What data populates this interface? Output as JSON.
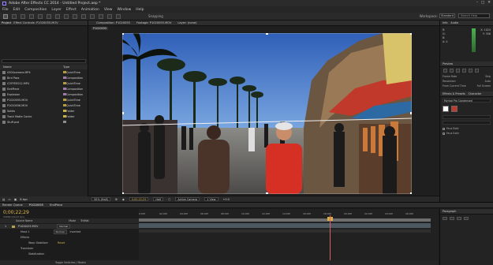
{
  "window": {
    "title": "Adobe After Effects CC 2014 - Untitled Project.aep *",
    "controls": [
      "–",
      "□",
      "✕"
    ]
  },
  "menu": [
    "File",
    "Edit",
    "Composition",
    "Layer",
    "Effect",
    "Animation",
    "View",
    "Window",
    "Help"
  ],
  "toolbar": {
    "snapping": "Snapping",
    "workspace_label": "Workspace:",
    "workspace_value": "Standard",
    "search_placeholder": "Search Help"
  },
  "project": {
    "tabs": [
      "Project",
      "Effect Controls: P1020055.MOV"
    ],
    "header_name": "Name",
    "header_type": "Type",
    "items": [
      {
        "name": "0300camera.MP4",
        "type": "QuickTime",
        "color": "#b39b42"
      },
      {
        "name": "Bird Pass",
        "type": "Composition",
        "color": "#a07aa6"
      },
      {
        "name": "COFFEE012.MP4",
        "type": "QuickTime",
        "color": "#b39b42"
      },
      {
        "name": "EndPiece",
        "type": "Composition",
        "color": "#a07aa6"
      },
      {
        "name": "Explosion",
        "type": "Composition",
        "color": "#a07aa6"
      },
      {
        "name": "P1020055.MOV",
        "type": "QuickTime",
        "color": "#b39b42"
      },
      {
        "name": "P1020056.MOV",
        "type": "QuickTime",
        "color": "#b39b42"
      },
      {
        "name": "Solids",
        "type": "Folder",
        "color": "#c7b24a"
      },
      {
        "name": "Track Matte Cache",
        "type": "Folder",
        "color": "#c7b24a"
      },
      {
        "name": "Stuff.psd",
        "type": "",
        "color": "#8d8d8d"
      }
    ],
    "bottom": "8 bpc"
  },
  "viewer": {
    "tabs": [
      "Composition: P1020055",
      "Footage: P1020055.MOV",
      "Layer: (none)"
    ],
    "crumb": "P1020055",
    "bottom": {
      "zoom": "50% (Half)",
      "timecode": "0;00;22;29",
      "resolution": "Half",
      "camera": "Active Camera",
      "views": "1 View",
      "exposure": "+0.0"
    }
  },
  "right_panels": {
    "info_tabs": [
      "Info",
      "Audio"
    ],
    "info": {
      "rgb": [
        "R:",
        "G:",
        "B:",
        "A: 0"
      ],
      "xy": [
        "X: 1024",
        "Y: 356"
      ]
    },
    "preview_tab": "Preview",
    "prefs": [
      {
        "label": "Frame Rate",
        "value": "Skip"
      },
      {
        "label": "Resolution",
        "value": "Auto"
      },
      {
        "label": "From Current Time",
        "value": "Full Screen"
      }
    ],
    "effects_tabs": [
      "Effects & Presets",
      "Character"
    ],
    "font": "Myriad Pro Condensed",
    "character_options": [
      "Faux Bold",
      "Faux Italic"
    ]
  },
  "timeline": {
    "tabs": [
      "Render Queue",
      "P1020055",
      "EndPiece"
    ],
    "timecode": "0;00;22;29",
    "fps": "00689 (29.97 fps)",
    "cols": [
      "Source Name",
      "Mode",
      "TrkMat"
    ],
    "layers": [
      {
        "idx": "1",
        "name": "P1020055.MOV",
        "mode": "Normal",
        "trkmat": ""
      },
      {
        "name": "Mask 1",
        "mode": "Normal",
        "trkmat": "Inverted"
      },
      {
        "name": "Effects"
      },
      {
        "name": "Warp Stabilizer",
        "value": "Reset"
      },
      {
        "name": "Transform"
      },
      {
        "name": "Stabilization"
      }
    ],
    "ruler": [
      "0:00f",
      "02:00f",
      "04:00f",
      "06:00f",
      "08:00f",
      "10:00f",
      "12:00f",
      "14:00f",
      "16:00f",
      "18:00f",
      "20:00f",
      "22:00f",
      "24:00f",
      "26:00f"
    ],
    "bottom": "Toggle Switches / Modes",
    "paragraph_tab": "Paragraph"
  }
}
